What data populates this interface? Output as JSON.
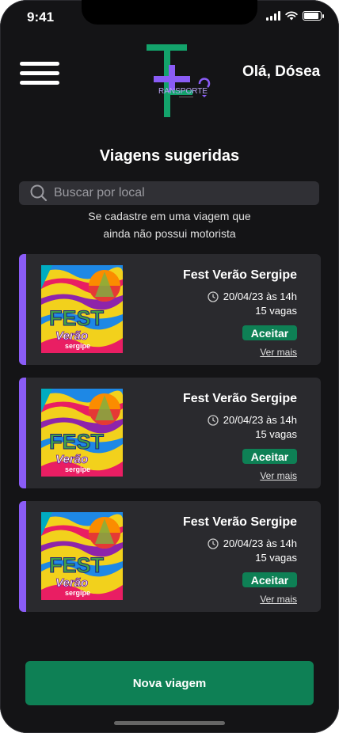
{
  "status": {
    "time": "9:41"
  },
  "header": {
    "logo_text": "RANSPORTE",
    "greeting": "Olá, Dósea"
  },
  "main": {
    "title": "Viagens sugeridas",
    "search_placeholder": "Buscar por local",
    "hint_line1": "Se cadastre em uma viagem que",
    "hint_line2": "ainda não possui motorista"
  },
  "trips": [
    {
      "title": "Fest Verão Sergipe",
      "date": "20/04/23 às 14h",
      "seats": "15 vagas",
      "accept_label": "Aceitar",
      "more_label": "Ver mais",
      "poster_word": "FEST",
      "poster_sub": "Verão",
      "poster_sub2": "sergipe"
    },
    {
      "title": "Fest Verão Sergipe",
      "date": "20/04/23 às 14h",
      "seats": "15 vagas",
      "accept_label": "Aceitar",
      "more_label": "Ver mais",
      "poster_word": "FEST",
      "poster_sub": "Verão",
      "poster_sub2": "sergipe"
    },
    {
      "title": "Fest Verão Sergipe",
      "date": "20/04/23 às 14h",
      "seats": "15 vagas",
      "accept_label": "Aceitar",
      "more_label": "Ver mais",
      "poster_word": "FEST",
      "poster_sub": "Verão",
      "poster_sub2": "sergipe"
    }
  ],
  "footer": {
    "new_trip_label": "Nova viagem"
  },
  "colors": {
    "background": "#141416",
    "card": "#2a2a2e",
    "accent": "#8a5cf6",
    "primary": "#0e8055",
    "logo_green": "#13a36b"
  }
}
